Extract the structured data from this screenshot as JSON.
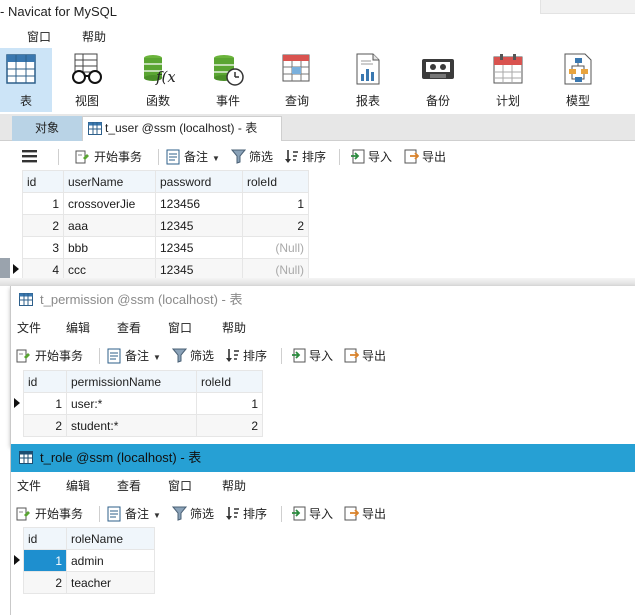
{
  "app": {
    "title": "- Navicat for MySQL"
  },
  "menubar": {
    "items": [
      "窗口",
      "帮助"
    ]
  },
  "toolbar": {
    "buttons": [
      {
        "label": "表",
        "icon": "table-icon",
        "active": true
      },
      {
        "label": "视图",
        "icon": "view-glasses-icon"
      },
      {
        "label": "函数",
        "icon": "function-icon"
      },
      {
        "label": "事件",
        "icon": "event-clock-icon"
      },
      {
        "label": "查询",
        "icon": "query-icon"
      },
      {
        "label": "报表",
        "icon": "report-icon"
      },
      {
        "label": "备份",
        "icon": "backup-tape-icon"
      },
      {
        "label": "计划",
        "icon": "calendar-icon"
      },
      {
        "label": "模型",
        "icon": "model-icon"
      }
    ]
  },
  "tabs": {
    "objects": "对象",
    "active": "t_user @ssm (localhost) - 表"
  },
  "tools": {
    "begin_tx": "开始事务",
    "memo": "备注",
    "filter": "筛选",
    "sort": "排序",
    "import": "导入",
    "export": "导出"
  },
  "user_table": {
    "headers": [
      "id",
      "userName",
      "password",
      "roleId"
    ],
    "rows": [
      {
        "id": "1",
        "userName": "crossoverJie",
        "password": "123456",
        "roleId": "1"
      },
      {
        "id": "2",
        "userName": "aaa",
        "password": "12345",
        "roleId": "2"
      },
      {
        "id": "3",
        "userName": "bbb",
        "password": "12345",
        "roleId": "(Null)"
      },
      {
        "id": "4",
        "userName": "ccc",
        "password": "12345",
        "roleId": "(Null)"
      }
    ]
  },
  "permission_window": {
    "title": "t_permission @ssm (localhost) - 表",
    "menu": [
      "文件",
      "编辑",
      "查看",
      "窗口",
      "帮助"
    ],
    "headers": [
      "id",
      "permissionName",
      "roleId"
    ],
    "rows": [
      {
        "id": "1",
        "permissionName": "user:*",
        "roleId": "1"
      },
      {
        "id": "2",
        "permissionName": "student:*",
        "roleId": "2"
      }
    ]
  },
  "role_window": {
    "title": "t_role @ssm (localhost) - 表",
    "menu": [
      "文件",
      "编辑",
      "查看",
      "窗口",
      "帮助"
    ],
    "headers": [
      "id",
      "roleName"
    ],
    "rows": [
      {
        "id": "1",
        "roleName": "admin"
      },
      {
        "id": "2",
        "roleName": "teacher"
      }
    ]
  },
  "colors": {
    "accent": "#26a0d4",
    "selection": "#1e8fcf",
    "toolbar_active": "#cce4f7"
  }
}
